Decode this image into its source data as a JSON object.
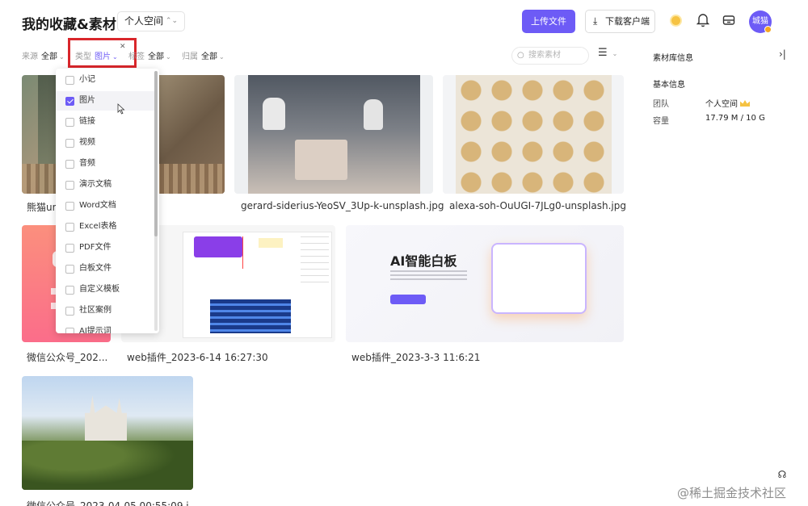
{
  "header": {
    "title": "我的收藏&素材",
    "space_select": "个人空间",
    "upload_label": "上传文件",
    "download_label": "下载客户端",
    "avatar_text": "城猫",
    "accent_color": "#6d5bf6"
  },
  "filters": {
    "source": {
      "label": "来源",
      "value": "全部"
    },
    "type": {
      "label": "类型",
      "value": "图片"
    },
    "tag": {
      "label": "标签",
      "value": "全部"
    },
    "owner": {
      "label": "归属",
      "value": "全部"
    }
  },
  "search": {
    "placeholder": "搜索素材"
  },
  "type_dropdown": {
    "options": [
      {
        "label": "小记",
        "checked": false
      },
      {
        "label": "图片",
        "checked": true
      },
      {
        "label": "链接",
        "checked": false
      },
      {
        "label": "视频",
        "checked": false
      },
      {
        "label": "音频",
        "checked": false
      },
      {
        "label": "演示文稿",
        "checked": false
      },
      {
        "label": "Word文档",
        "checked": false
      },
      {
        "label": "Excel表格",
        "checked": false
      },
      {
        "label": "PDF文件",
        "checked": false
      },
      {
        "label": "白板文件",
        "checked": false
      },
      {
        "label": "自定义模板",
        "checked": false
      },
      {
        "label": "社区案例",
        "checked": false
      },
      {
        "label": "AI提示词",
        "checked": false
      }
    ]
  },
  "panel": {
    "title": "素材库信息",
    "section": "基本信息",
    "team_label": "团队",
    "team_value": "个人空间",
    "capacity_label": "容量",
    "capacity_value": "17.79 M / 10 G"
  },
  "cards": [
    {
      "name": "熊猫un"
    },
    {
      "name": "gerard-siderius-YeoSV_3Up-k-unsplash.jpg"
    },
    {
      "name": "alexa-soh-OuUGI-7JLg0-unsplash.jpg"
    },
    {
      "name": "微信公众号_202..."
    },
    {
      "name": "web插件_2023-6-14 16:27:30"
    },
    {
      "name": "web插件_2023-3-3 11:6:21",
      "thumb_title": "AI智能白板"
    },
    {
      "name": "微信公众号_2023-04-05 00:55:09.j"
    }
  ],
  "watermark": "@稀土掘金技术社区"
}
